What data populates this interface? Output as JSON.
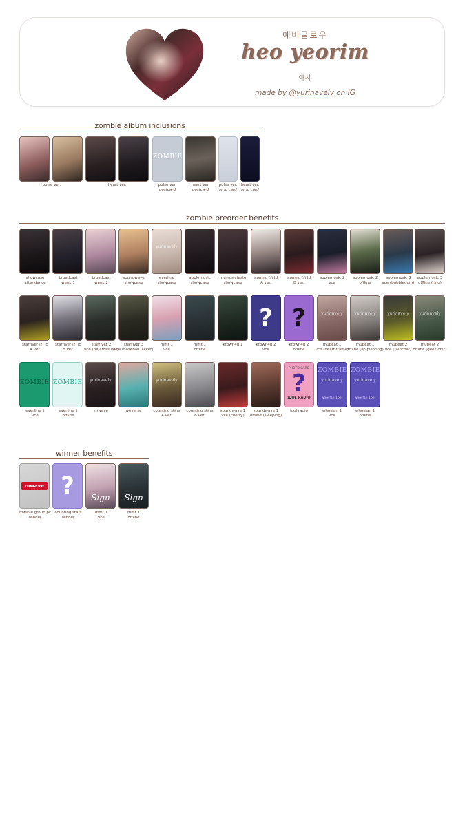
{
  "header": {
    "hangul_top": "에버글로우",
    "name": "heo yeorim",
    "hangul_bottom": "아샤",
    "made_by_prefix": "made by ",
    "handle": "@yurinavely",
    "made_by_suffix": " on IG"
  },
  "sections": {
    "album": "zombie album inclusions",
    "preorder": "zombie preorder benefits",
    "winner": "winner benefits"
  },
  "album_labels": [
    {
      "l1": "pulse ver.",
      "l2": ""
    },
    {
      "l1": "heart ver.",
      "l2": ""
    },
    {
      "l1": "pulse ver.",
      "l2": "postcard"
    },
    {
      "l1": "heart ver.",
      "l2": "postcard"
    },
    {
      "l1": "pulse ver.",
      "l2": "lyric card"
    },
    {
      "l1": "heart ver.",
      "l2": "lyric card"
    }
  ],
  "preorder_row1": [
    {
      "l1": "showcase",
      "l2": "attendance"
    },
    {
      "l1": "broadcast",
      "l2": "week 1"
    },
    {
      "l1": "broadcast",
      "l2": "week 2"
    },
    {
      "l1": "soundwave",
      "l2": "showcase"
    },
    {
      "l1": "everline",
      "l2": "showcase"
    },
    {
      "l1": "applemusic",
      "l2": "showcase"
    },
    {
      "l1": "mymusictaste",
      "l2": "showcase"
    },
    {
      "l1": "appmu (f) ld",
      "l2": "A ver."
    },
    {
      "l1": "appmu (f) ld",
      "l2": "B ver."
    },
    {
      "l1": "applemusic 2",
      "l2": "vce"
    },
    {
      "l1": "applemusic 2",
      "l2": "offline"
    },
    {
      "l1": "applemusic 3",
      "l2": "vce (bubblegum)"
    },
    {
      "l1": "applemusic 3",
      "l2": "offline (ring)"
    }
  ],
  "preorder_row2": [
    {
      "l1": "starriver (f) ld",
      "l2": "A ver."
    },
    {
      "l1": "starriver (f) ld",
      "l2": "B ver."
    },
    {
      "l1": "starriver 2",
      "l2": "vce (pajamas ver)"
    },
    {
      "l1": "starriver 3",
      "l2": "vce (baseball jacket)"
    },
    {
      "l1": "mmt 1",
      "l2": "vce"
    },
    {
      "l1": "mmt 1",
      "l2": "offline"
    },
    {
      "l1": "ktown4u 1",
      "l2": ""
    },
    {
      "l1": "ktown4u 2",
      "l2": "vce"
    },
    {
      "l1": "ktown4u 2",
      "l2": "offline"
    },
    {
      "l1": "mubeat 1",
      "l2": "vce (heart frame)"
    },
    {
      "l1": "mubeat 1",
      "l2": "offline (lip piercing)"
    },
    {
      "l1": "mubeat 2",
      "l2": "vce (raincoat)"
    },
    {
      "l1": "mubeat 2",
      "l2": "offline (geek chic)"
    }
  ],
  "preorder_row3": [
    {
      "l1": "everline 1",
      "l2": "vce"
    },
    {
      "l1": "everline 1",
      "l2": "offline"
    },
    {
      "l1": "mwave",
      "l2": ""
    },
    {
      "l1": "weverse",
      "l2": ""
    },
    {
      "l1": "counting stars",
      "l2": "A ver."
    },
    {
      "l1": "counting stars",
      "l2": "B ver."
    },
    {
      "l1": "soundwave 1",
      "l2": "vce (cherry)"
    },
    {
      "l1": "soundwave 1",
      "l2": "offline (sleeping)"
    },
    {
      "l1": "idol radio",
      "l2": ""
    },
    {
      "l1": "whosfan 1",
      "l2": "vce"
    },
    {
      "l1": "whosfan 1",
      "l2": "offline"
    }
  ],
  "winner_labels": [
    {
      "l1": "mwave group pc",
      "l2": "winner"
    },
    {
      "l1": "counting stars",
      "l2": "winner"
    },
    {
      "l1": "mmt 1",
      "l2": "vce"
    },
    {
      "l1": "mmt 1",
      "l2": "offline"
    }
  ],
  "card_text": {
    "question": "?",
    "zombie": "ZOMBIE",
    "watermark": "yurinavely",
    "sign": "Sign",
    "mwave": "mwave",
    "photo_card": "PHOTO CARD",
    "idol_radio": "IDOL RADIO",
    "whosfan_credit": "whosfan 1ber"
  }
}
